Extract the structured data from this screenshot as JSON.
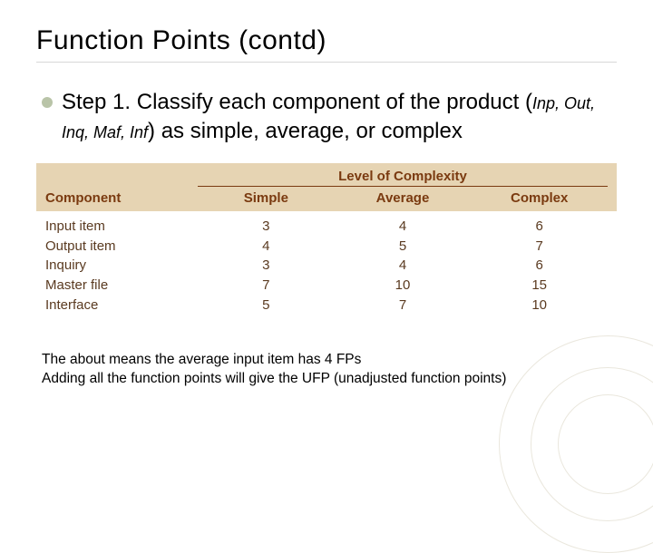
{
  "title": "Function Points (contd)",
  "step": {
    "label": "Step 1.",
    "body_before": "Classify each component of the product (",
    "params": "Inp, Out, Inq, Maf, Inf",
    "body_after": ") as simple, average, or complex"
  },
  "table": {
    "component_header": "Component",
    "loc_header": "Level of Complexity",
    "cols": {
      "simple": "Simple",
      "average": "Average",
      "complex": "Complex"
    },
    "rows": [
      {
        "name": "Input item",
        "simple": "3",
        "average": "4",
        "complex": "6"
      },
      {
        "name": "Output item",
        "simple": "4",
        "average": "5",
        "complex": "7"
      },
      {
        "name": "Inquiry",
        "simple": "3",
        "average": "4",
        "complex": "6"
      },
      {
        "name": "Master file",
        "simple": "7",
        "average": "10",
        "complex": "15"
      },
      {
        "name": "Interface",
        "simple": "5",
        "average": "7",
        "complex": "10"
      }
    ]
  },
  "footnote": {
    "line1": "The about means the average input item has 4 FPs",
    "line2": "Adding all the function points will give the UFP (unadjusted function points)"
  },
  "chart_data": {
    "type": "table",
    "title": "Level of Complexity",
    "columns": [
      "Component",
      "Simple",
      "Average",
      "Complex"
    ],
    "rows": [
      [
        "Input item",
        3,
        4,
        6
      ],
      [
        "Output item",
        4,
        5,
        7
      ],
      [
        "Inquiry",
        3,
        4,
        6
      ],
      [
        "Master file",
        7,
        10,
        15
      ],
      [
        "Interface",
        5,
        7,
        10
      ]
    ]
  }
}
